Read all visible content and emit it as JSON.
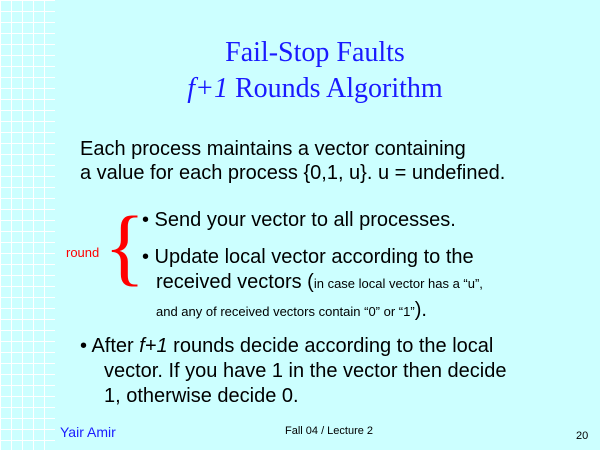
{
  "title": {
    "line1": "Fail-Stop Faults",
    "line2_italic": "f+1",
    "line2_rest": " Rounds Algorithm"
  },
  "intro": {
    "line1": "Each process maintains a vector containing",
    "line2": "a value for each process {0,1, u}. u = undefined."
  },
  "round_label": "round",
  "bullets": {
    "send": "• Send your vector to all processes.",
    "update_line1": "• Update local vector according to the",
    "update_line2_main": "received vectors (",
    "update_line2_small": "in case local vector has a “u”,",
    "update_line3_small": "and any of received vectors contain “0” or “1”",
    "update_line3_end": ").",
    "after_prefix": "• After ",
    "after_italic": "f+1",
    "after_rest": " rounds decide according to the local",
    "after_line2": "vector. If you have 1 in the vector then decide",
    "after_line3": "1, otherwise decide 0."
  },
  "footer": {
    "author": "Yair Amir",
    "course": "Fall 04 / Lecture 2",
    "page": "20"
  },
  "colors": {
    "background": "#ccffff",
    "title": "#1a1aff",
    "brace": "#ff0000"
  }
}
